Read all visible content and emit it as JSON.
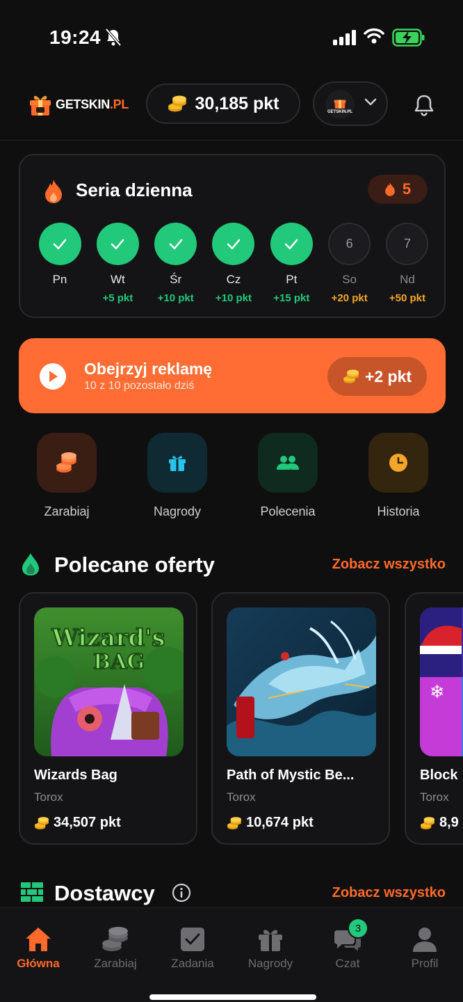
{
  "status_bar": {
    "time": "19:24"
  },
  "header": {
    "logo_text_main": "GETSKIN",
    "logo_text_suffix": ".PL",
    "points": "30,185 pkt",
    "brand_avatar_text": "GETSKIN.PL"
  },
  "streak": {
    "title": "Seria dzienna",
    "count": "5",
    "days": [
      {
        "name": "Pn",
        "done": true,
        "reward": ""
      },
      {
        "name": "Wt",
        "done": true,
        "reward": "+5 pkt"
      },
      {
        "name": "Śr",
        "done": true,
        "reward": "+10 pkt"
      },
      {
        "name": "Cz",
        "done": true,
        "reward": "+10 pkt"
      },
      {
        "name": "Pt",
        "done": true,
        "reward": "+15 pkt"
      },
      {
        "name": "So",
        "done": false,
        "number": "6",
        "reward": "+20 pkt"
      },
      {
        "name": "Nd",
        "done": false,
        "number": "7",
        "reward": "+50 pkt"
      }
    ]
  },
  "ad": {
    "title": "Obejrzyj reklamę",
    "subtitle": "10 z 10 pozostało dziś",
    "reward": "+2 pkt"
  },
  "quick_actions": [
    {
      "label": "Zarabiaj",
      "icon": "coins-icon",
      "color": "#ff6a2b"
    },
    {
      "label": "Nagrody",
      "icon": "gift-icon",
      "color": "#27c3e8"
    },
    {
      "label": "Polecenia",
      "icon": "users-icon",
      "color": "#22c97a"
    },
    {
      "label": "Historia",
      "icon": "clock-icon",
      "color": "#f4a62a"
    }
  ],
  "featured": {
    "title": "Polecane oferty",
    "see_all": "Zobacz wszystko",
    "offers": [
      {
        "name": "Wizards Bag",
        "publisher": "Torox",
        "points": "34,507 pkt",
        "thumb_text": "Wizard's BAG"
      },
      {
        "name": "Path of Mystic Be...",
        "publisher": "Torox",
        "points": "10,674 pkt"
      },
      {
        "name": "Block",
        "publisher": "Torox",
        "points": "8,9"
      }
    ]
  },
  "providers": {
    "title": "Dostawcy",
    "see_all": "Zobacz wszystko"
  },
  "bottom_nav": [
    {
      "label": "Główna",
      "icon": "home-icon",
      "active": true
    },
    {
      "label": "Zarabiaj",
      "icon": "coins-icon",
      "active": false
    },
    {
      "label": "Zadania",
      "icon": "checkbox-icon",
      "active": false
    },
    {
      "label": "Nagrody",
      "icon": "gift-icon",
      "active": false
    },
    {
      "label": "Czat",
      "icon": "chat-icon",
      "active": false,
      "badge": "3"
    },
    {
      "label": "Profil",
      "icon": "user-icon",
      "active": false
    }
  ],
  "colors": {
    "accent": "#ff6a2b",
    "success": "#22c97a",
    "gold": "#f4a62a",
    "background": "#0f0f10"
  }
}
